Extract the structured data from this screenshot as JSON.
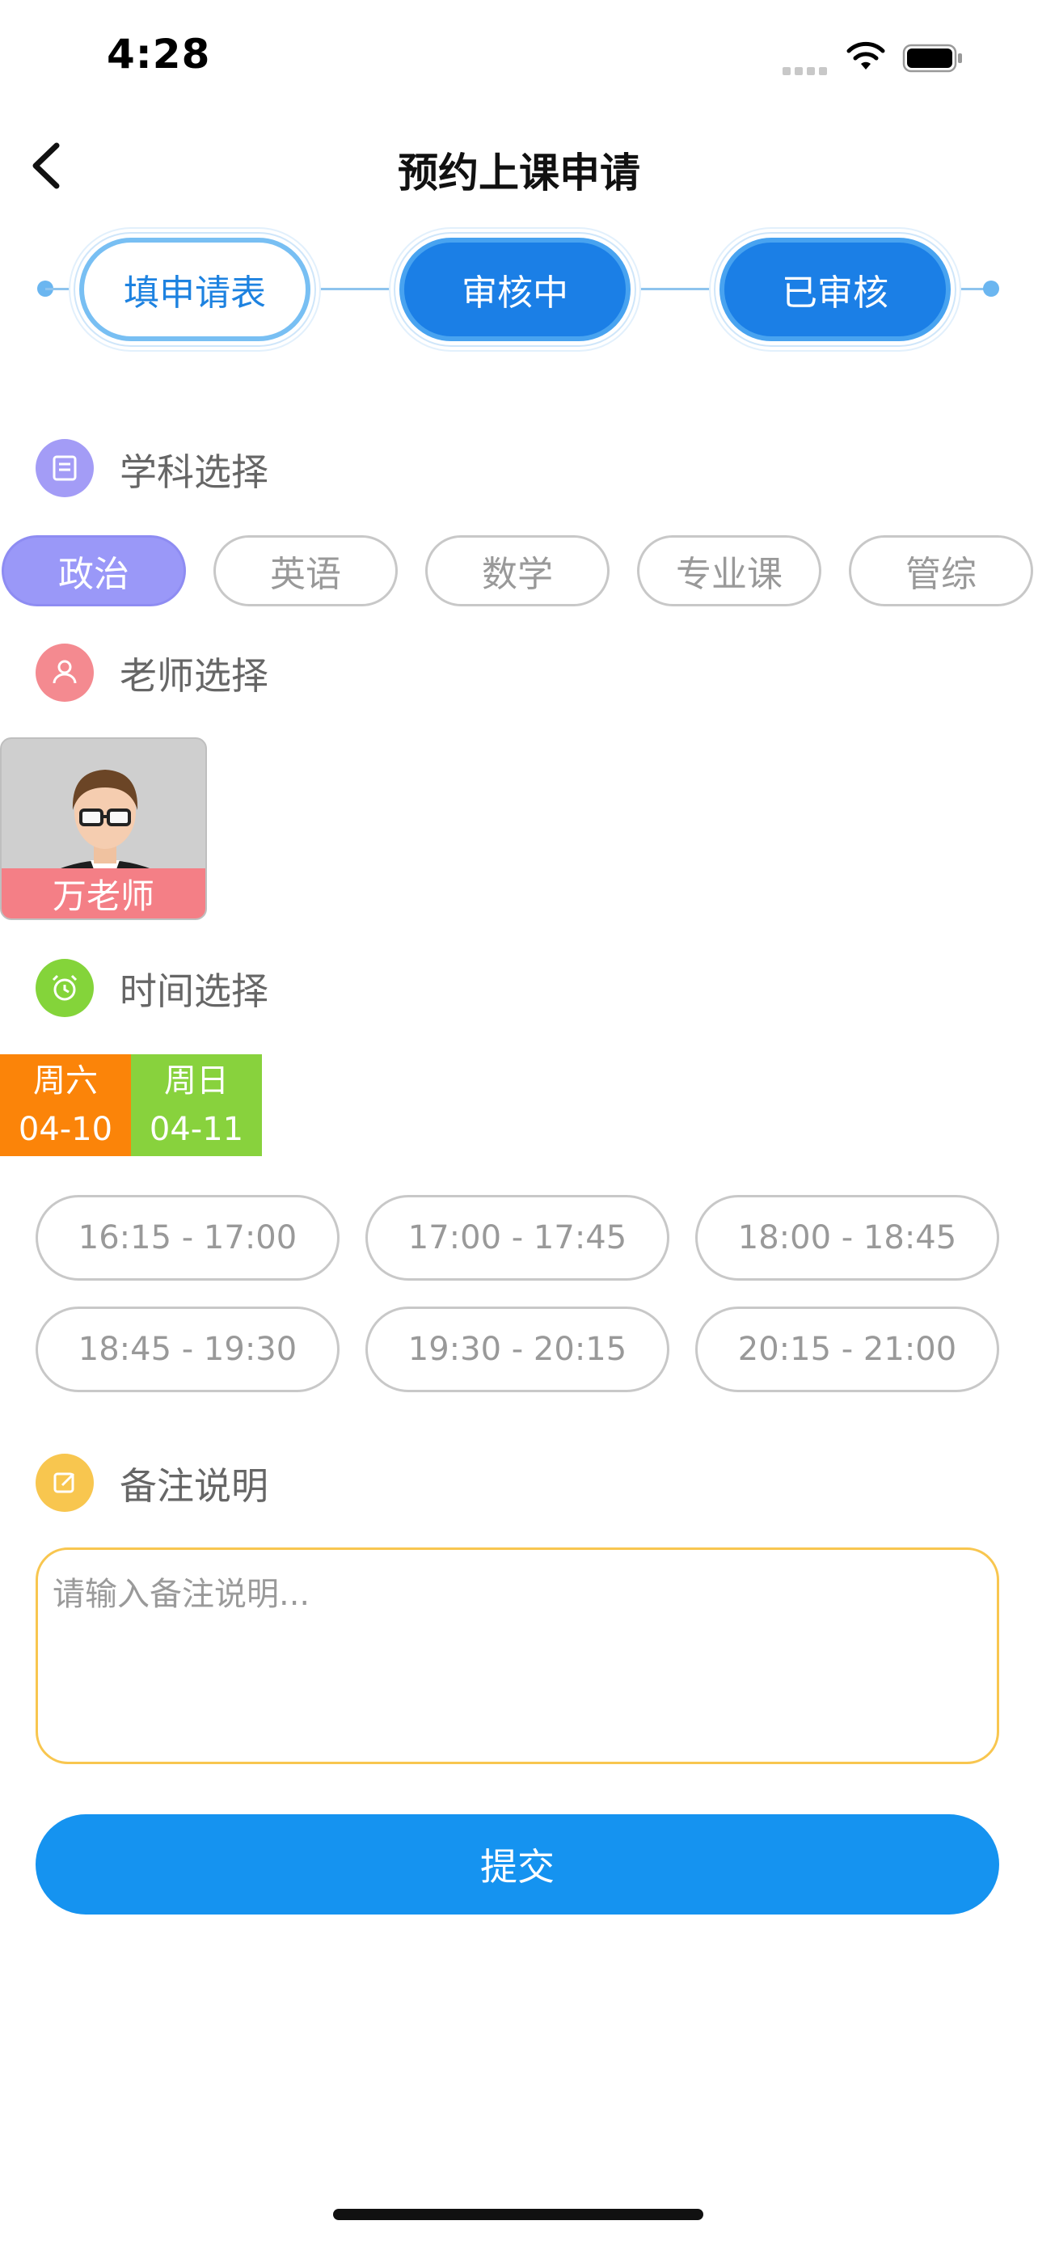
{
  "status": {
    "time": "4:28"
  },
  "nav": {
    "title": "预约上课申请"
  },
  "steps": [
    {
      "label": "填申请表",
      "state": "current"
    },
    {
      "label": "审核中",
      "state": "filled"
    },
    {
      "label": "已审核",
      "state": "filled"
    }
  ],
  "subject": {
    "heading": "学科选择",
    "options": [
      "政治",
      "英语",
      "数学",
      "专业课",
      "管综"
    ],
    "selected": "政治"
  },
  "teacher": {
    "heading": "老师选择",
    "name": "万老师"
  },
  "time": {
    "heading": "时间选择",
    "days": [
      {
        "weekday": "周六",
        "date": "04-10",
        "color": "#fb8409"
      },
      {
        "weekday": "周日",
        "date": "04-11",
        "color": "#88d23d"
      }
    ],
    "slots": [
      "16:15 - 17:00",
      "17:00 - 17:45",
      "18:00 - 18:45",
      "18:45 - 19:30",
      "19:30 - 20:15",
      "20:15 - 21:00"
    ]
  },
  "note": {
    "heading": "备注说明",
    "placeholder": "请输入备注说明..."
  },
  "submit_label": "提交",
  "colors": {
    "primary": "#1593f0",
    "subject_selected": "#9a98f8",
    "subject_icon": "#a39cf6",
    "teacher_icon": "#f48a90",
    "time_icon": "#84d43a",
    "note_icon": "#f8c64f"
  }
}
